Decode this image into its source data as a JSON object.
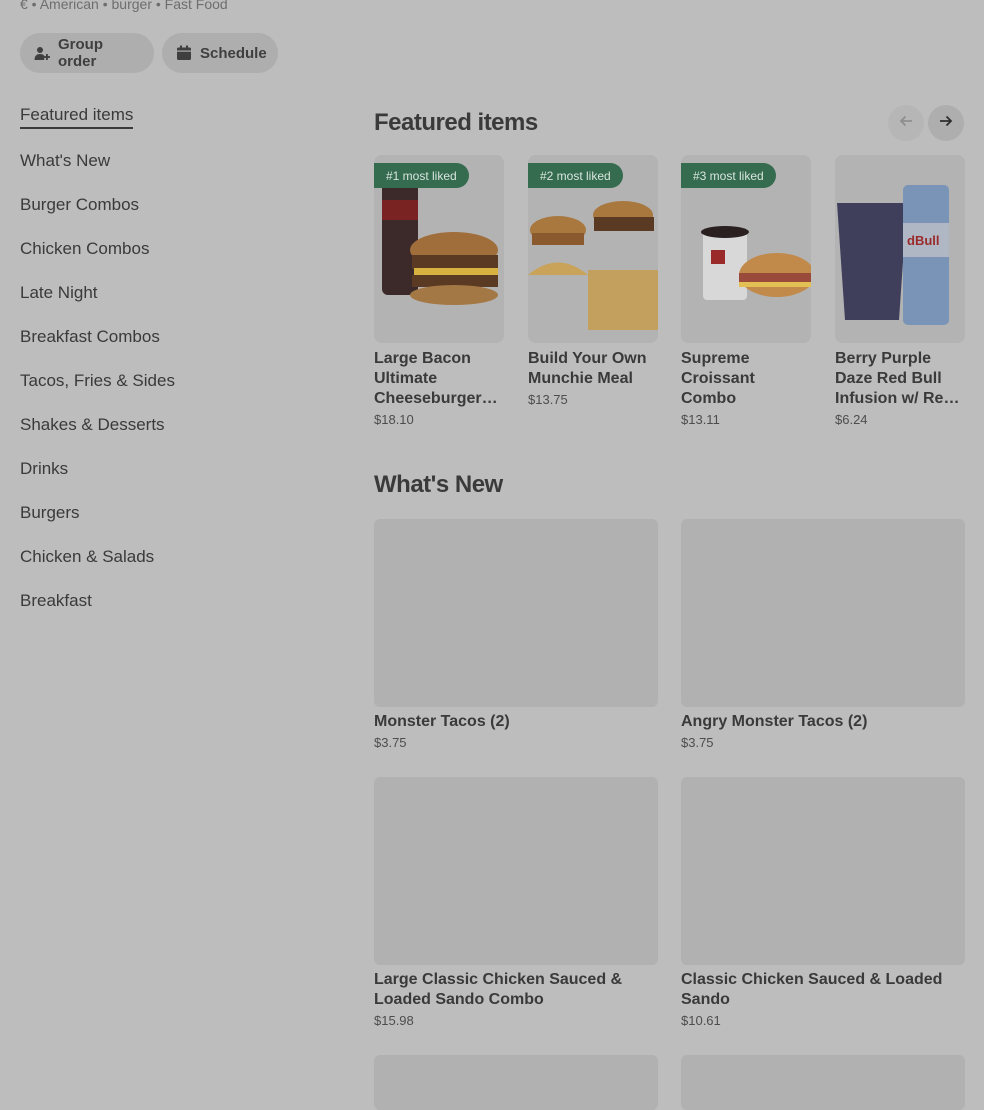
{
  "store": {
    "meta": "€ • American • burger • Fast Food"
  },
  "actions": {
    "group_order": "Group order",
    "schedule": "Schedule"
  },
  "sidebar": {
    "items": [
      {
        "label": "Featured items"
      },
      {
        "label": "What's New"
      },
      {
        "label": "Burger Combos"
      },
      {
        "label": "Chicken Combos"
      },
      {
        "label": "Late Night"
      },
      {
        "label": "Breakfast Combos"
      },
      {
        "label": "Tacos, Fries & Sides"
      },
      {
        "label": "Shakes & Desserts"
      },
      {
        "label": "Drinks"
      },
      {
        "label": "Burgers"
      },
      {
        "label": "Chicken & Salads"
      },
      {
        "label": "Breakfast"
      }
    ]
  },
  "featured": {
    "title": "Featured items",
    "items": [
      {
        "badge": "#1 most liked",
        "name": "Large Bacon Ultimate Cheeseburger™ Combo",
        "price": "$18.10"
      },
      {
        "badge": "#2 most liked",
        "name": "Build Your Own Munchie Meal",
        "price": "$13.75"
      },
      {
        "badge": "#3 most liked",
        "name": "Supreme Croissant Combo",
        "price": "$13.11"
      },
      {
        "badge": "",
        "name": "Berry Purple Daze Red Bull Infusion w/ Red Bull",
        "price": "$6.24"
      }
    ]
  },
  "whats_new": {
    "title": "What's New",
    "items": [
      {
        "name": "Monster Tacos (2)",
        "price": "$3.75"
      },
      {
        "name": "Angry Monster Tacos (2)",
        "price": "$3.75"
      },
      {
        "name": "Large Classic Chicken Sauced & Loaded Sando Combo",
        "price": "$15.98"
      },
      {
        "name": "Classic Chicken Sauced & Loaded Sando",
        "price": "$10.61"
      }
    ]
  },
  "colors": {
    "overlay": "#bdbdbd",
    "badge": "#356b4f"
  }
}
